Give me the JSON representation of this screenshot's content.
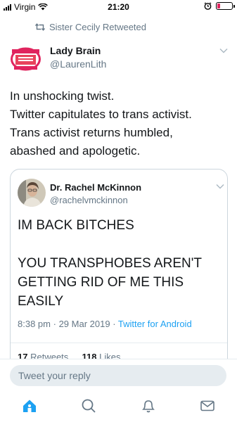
{
  "status_bar": {
    "carrier": "Virgin",
    "time": "21:20"
  },
  "retweet_context": {
    "text": "Sister Cecily Retweeted"
  },
  "tweet": {
    "display_name": "Lady Brain",
    "handle": "@LaurenLith",
    "text_lines": [
      "In unshocking twist.",
      "Twitter capitulates to trans activist.",
      "Trans activist returns humbled,",
      "abashed and apologetic."
    ]
  },
  "quoted_tweet": {
    "display_name": "Dr. Rachel McKinnon",
    "handle": "@rachelvmckinnon",
    "text_line_1": "IM BACK BITCHES",
    "text_line_2": "YOU TRANSPHOBES AREN'T GETTING RID OF ME THIS EASILY",
    "time": "8:38 pm",
    "date": "29 Mar 2019",
    "source": "Twitter for Android",
    "retweets_count": "17",
    "retweets_label": "Retweets",
    "likes_count": "118",
    "likes_label": "Likes"
  },
  "reply": {
    "placeholder": "Tweet your reply"
  },
  "tab_bar": {
    "items": [
      "home-icon",
      "search-icon",
      "notifications-icon",
      "messages-icon"
    ],
    "active": "home-icon"
  },
  "colors": {
    "accent": "#1da1f2",
    "secondary_text": "#657786",
    "battery_low": "#e0245e"
  }
}
